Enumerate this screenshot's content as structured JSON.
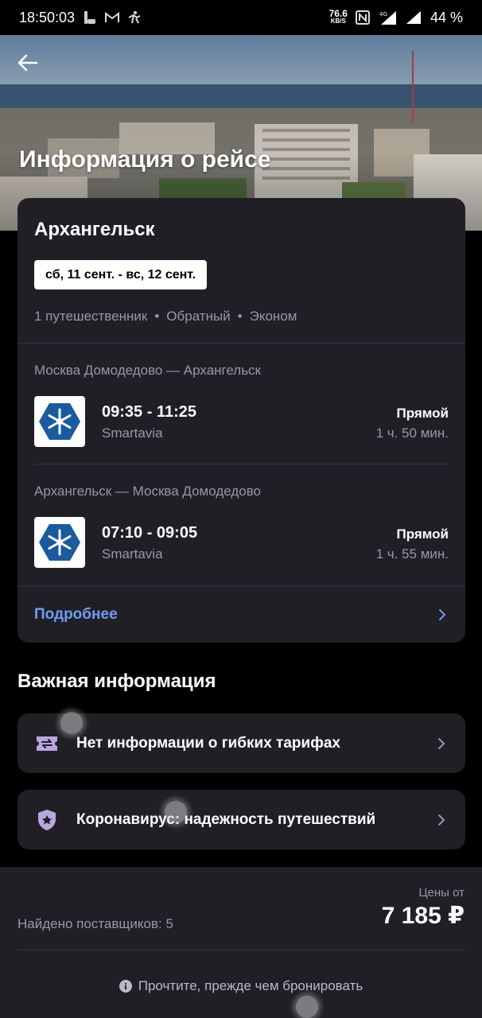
{
  "status_bar": {
    "time": "18:50:03",
    "net_speed": "76.6",
    "net_unit": "KB/S",
    "network": "4G",
    "battery": "44 %"
  },
  "hero": {
    "title": "Информация о рейсе"
  },
  "trip": {
    "city": "Архангельск",
    "dates": "сб, 11 сент. - вс, 12 сент.",
    "travellers": "1 путешественник",
    "trip_type": "Обратный",
    "cabin": "Эконом",
    "separator": "•"
  },
  "flights": [
    {
      "route": "Москва Домодедово — Архангельск",
      "times": "09:35 - 11:25",
      "airline": "Smartavia",
      "stops": "Прямой",
      "duration": "1 ч. 50 мин."
    },
    {
      "route": "Архангельск — Москва Домодедово",
      "times": "07:10 - 09:05",
      "airline": "Smartavia",
      "stops": "Прямой",
      "duration": "1 ч. 55 мин."
    }
  ],
  "details_link": "Подробнее",
  "important": {
    "title": "Важная информация",
    "items": [
      {
        "label": "Нет информации о гибких тарифах",
        "icon": "ticket-swap-icon"
      },
      {
        "label": "Коронавирус: надежность путешествий",
        "icon": "shield-star-icon"
      }
    ]
  },
  "footer": {
    "prices_from": "Цены от",
    "price": "7 185 ₽",
    "providers": "Найдено поставщиков: 5",
    "read_before": "Прочтите, прежде чем бронировать"
  },
  "colors": {
    "accent_link": "#6e9ef2",
    "card_bg": "#211f26",
    "icon_purple": "#b9a6e0",
    "airline_blue": "#1a5a9e"
  }
}
